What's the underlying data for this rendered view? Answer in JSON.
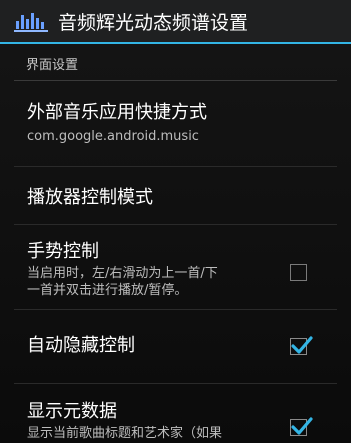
{
  "actionbar": {
    "title": "音频辉光动态频谱设置",
    "icon": "spectrum-icon"
  },
  "category": {
    "label": "界面设置"
  },
  "items": [
    {
      "title": "外部音乐应用快捷方式",
      "summary": "com.google.android.music"
    },
    {
      "title": "播放器控制模式"
    },
    {
      "title": "手势控制",
      "summary1": "当启用时，左/右滑动为上一首/下",
      "summary2": "一首并双击进行播放/暂停。",
      "checked": false
    },
    {
      "title": "自动隐藏控制",
      "checked": true
    },
    {
      "title": "显示元数据",
      "summary1": "显示当前歌曲标题和艺术家（如果",
      "checked": true
    }
  ],
  "colors": {
    "accent": "#33b5e5",
    "check": "#33b5e5"
  }
}
